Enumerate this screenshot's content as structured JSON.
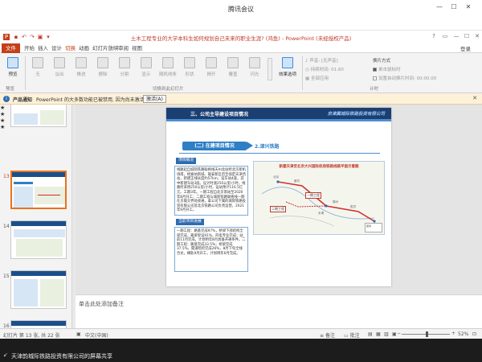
{
  "meeting": {
    "title": "腾讯会议"
  },
  "window": {
    "title": "土木工程专业的大学本科生如何规划自己未来的职业生涯? (鸿鱼) - PowerPoint (未经授权产品)"
  },
  "ribbon_tabs": [
    "文件",
    "开始",
    "插入",
    "设计",
    "切换",
    "动画",
    "幻灯片放映",
    "审阅",
    "视图"
  ],
  "active_tab": "切换",
  "account": {
    "login": "登录"
  },
  "ribbon": {
    "preview_label": "预览",
    "preview_group": "预览",
    "transitions": [
      "无",
      "淡出",
      "推进",
      "擦除",
      "分割",
      "显示",
      "随机线条",
      "形状",
      "揭开",
      "覆盖",
      "闪光"
    ],
    "effects_label": "效果选项",
    "transition_group": "切换到此幻灯片",
    "sound_label": "声音:",
    "sound_value": "[无声音]",
    "duration_label": "持续时间:",
    "duration_value": "01.60",
    "apply_all": "全部应用",
    "advance_heading": "换片方式",
    "on_click": "单击鼠标时",
    "after_label": "设置自动换片时间:",
    "after_value": "00:00.00",
    "timing_group": "计时"
  },
  "notice": {
    "heading": "产品通知",
    "message": "PowerPoint 的大多数功能已被禁用, 因为尚未激活。",
    "button": "激活(A)"
  },
  "thumbnails": [
    {
      "num": "12"
    },
    {
      "num": "13"
    },
    {
      "num": "14"
    },
    {
      "num": "15"
    },
    {
      "num": "16"
    }
  ],
  "selected_slide": "13",
  "slide": {
    "header": "三、公司主导建设项目情况",
    "company": "京津冀城际铁路投资有限公司",
    "section_a": "(二) 在建项目情况",
    "section_b": "2.津兴铁路",
    "tag1": "项目概况",
    "para1": "线路起自城际铁路联络线天州北站经北京新机场南，经廊坊新城、雄安新区后至保定天津西站，新建正线长度约57km，设车站4座，其中新建车站3座。设计时速250公里/小时，线路所采用250公里/小时，设站预计116.5亿元。工期3年。一期工程自北京南站至2020年8月开工；二期工程与城际铁路联络线一期在京雄交界处接通，拿公司下属的城际铁路投资有限公司及北京铁路公司负责运营，2021年9月开工。",
    "tag2": "当前项目进展",
    "para2": "一期工程：路基完成97%，桥梁下部结构全部完成，箱梁架设91%，四电专业完成；站前11月完成，计划明年8月具备开通条件。二期工程：路基完成33.5%；桥梁完成37.5%，隧道暗挖完成26%，8月下旬全线合龙，横轨9月开工，计划明年6月完成。",
    "map_title": "新建天津至北京大兴国际机场铁路线路平面示意图",
    "map_labels": [
      "一期工程",
      "二期工程"
    ],
    "map_towns": [
      "北京",
      "廊坊",
      "永清",
      "霸州",
      "胜芳",
      "天津"
    ],
    "map_legend": "图例"
  },
  "notes": {
    "placeholder": "单击此处添加备注"
  },
  "status": {
    "slide_info": "幻灯片 第 13 张, 共 22 张",
    "language": "中文(中国)",
    "notes_btn": "备注",
    "comments_btn": "批注",
    "zoom": "52%",
    "zoom_level": 0.52
  },
  "share": {
    "text": "天津韵城际铁路投资有限公司的屏幕共享"
  },
  "colors": {
    "accent": "#c43e1c",
    "slide_header": "#1c3f72",
    "slide_blue": "#2e7fc6",
    "share_bg": "#1c1c1c"
  }
}
